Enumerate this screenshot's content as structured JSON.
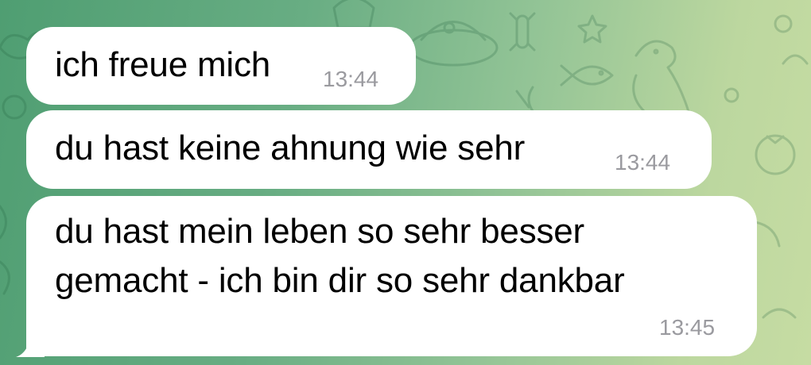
{
  "chat": {
    "wallpaper": {
      "gradient_colors": [
        "#4f9e72",
        "#93c496",
        "#c6dca3"
      ]
    },
    "messages": [
      {
        "text": "ich freue mich",
        "time": "13:44"
      },
      {
        "text": "du hast keine ahnung wie sehr",
        "time": "13:44"
      },
      {
        "text": "du hast mein leben so sehr besser\ngemacht - ich bin dir so sehr dankbar",
        "time": "13:45"
      }
    ]
  },
  "colors": {
    "bubble": "#ffffff",
    "text": "#000000",
    "timestamp": "#9a9a9f"
  }
}
